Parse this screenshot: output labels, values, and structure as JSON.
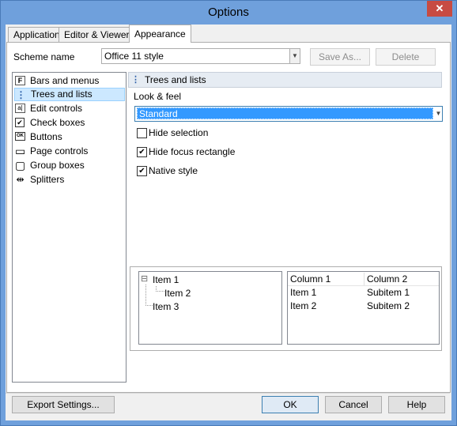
{
  "window": {
    "title": "Options",
    "close_label": "✕"
  },
  "tabs": [
    {
      "label": "Application",
      "active": false
    },
    {
      "label": "Editor & Viewers",
      "active": false
    },
    {
      "label": "Appearance",
      "active": true
    }
  ],
  "scheme": {
    "label": "Scheme name",
    "value": "Office 11 style",
    "save_as": "Save As...",
    "delete": "Delete"
  },
  "nav": {
    "items": [
      {
        "label": "Bars and menus",
        "icon": "bars-menus-icon",
        "glyph": "F"
      },
      {
        "label": "Trees and lists",
        "icon": "tree-icon",
        "glyph": "⋮",
        "selected": true
      },
      {
        "label": "Edit controls",
        "icon": "edit-control-icon",
        "glyph": "a|"
      },
      {
        "label": "Check boxes",
        "icon": "checkbox-icon",
        "glyph": "✔"
      },
      {
        "label": "Buttons",
        "icon": "button-icon",
        "glyph": "OK"
      },
      {
        "label": "Page controls",
        "icon": "page-control-icon",
        "glyph": "▭"
      },
      {
        "label": "Group boxes",
        "icon": "group-box-icon",
        "glyph": "▢"
      },
      {
        "label": "Splitters",
        "icon": "splitter-icon",
        "glyph": "⇹"
      }
    ]
  },
  "panel": {
    "header": "Trees and lists",
    "look_feel_label": "Look & feel",
    "look_feel_value": "Standard",
    "options": [
      {
        "label": "Hide selection",
        "checked": false
      },
      {
        "label": "Hide focus rectangle",
        "checked": true
      },
      {
        "label": "Native style",
        "checked": true
      }
    ]
  },
  "preview": {
    "tree": [
      {
        "label": "Item 1",
        "expander": "⊟"
      },
      {
        "label": "Item 2"
      },
      {
        "label": "Item 3"
      }
    ],
    "grid": {
      "columns": [
        "Column 1",
        "Column 2"
      ],
      "rows": [
        [
          "Item 1",
          "Subitem 1"
        ],
        [
          "Item 2",
          "Subitem 2"
        ]
      ]
    }
  },
  "footer": {
    "export": "Export Settings...",
    "ok": "OK",
    "cancel": "Cancel",
    "help": "Help"
  }
}
